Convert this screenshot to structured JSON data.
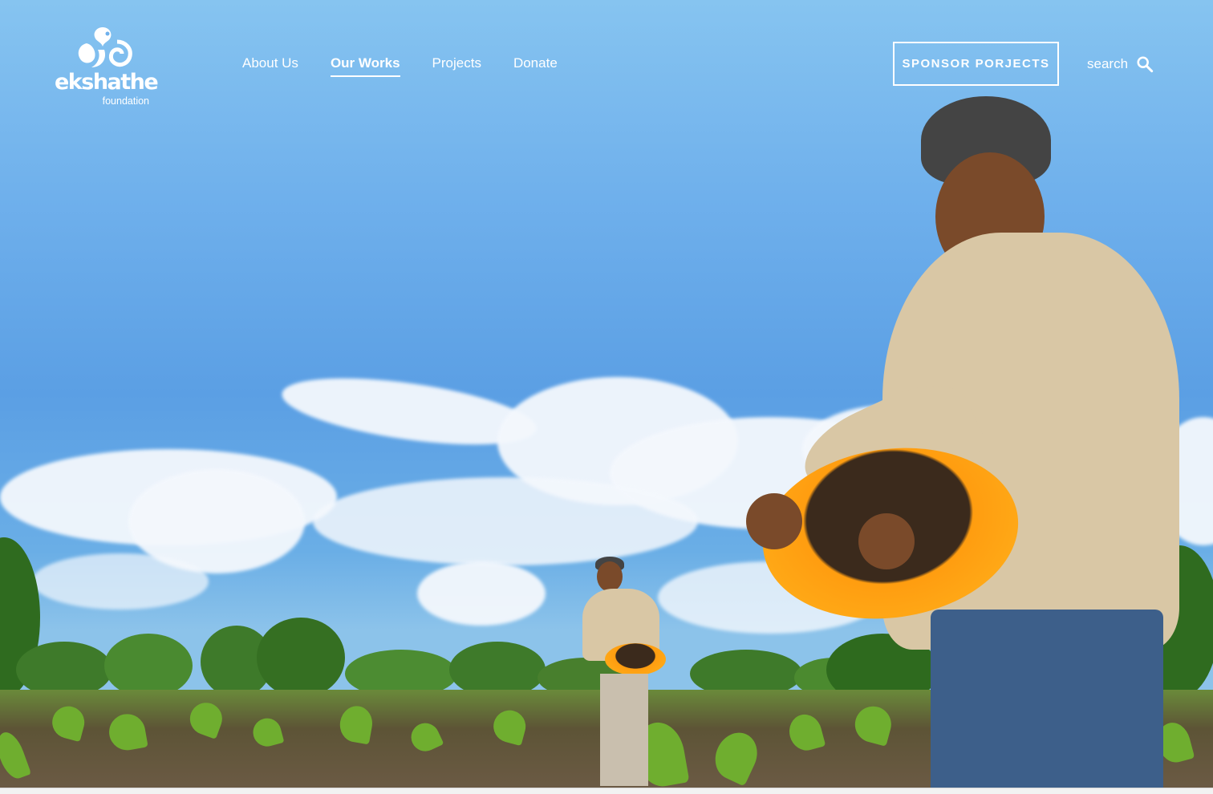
{
  "brand": {
    "name": "ekshathe",
    "sub": "foundation"
  },
  "nav": {
    "items": [
      {
        "label": "About Us",
        "active": false
      },
      {
        "label": "Our Works",
        "active": true
      },
      {
        "label": "Projects",
        "active": false
      },
      {
        "label": "Donate",
        "active": false
      }
    ]
  },
  "header": {
    "sponsor_label": "SPONSOR PORJECTS",
    "search_label": "search",
    "search_icon": "search-icon"
  },
  "colors": {
    "text": "#ffffff",
    "sky": "#6fb0ec",
    "basin": "#ffa41a"
  }
}
